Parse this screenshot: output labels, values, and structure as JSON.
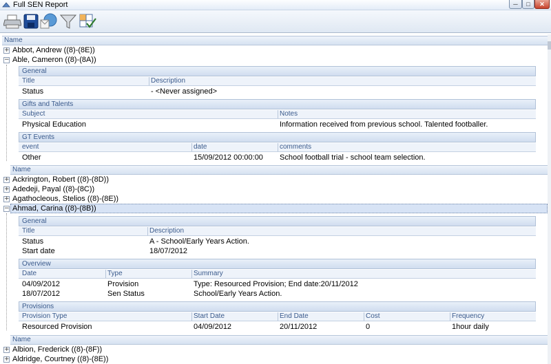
{
  "window": {
    "title": "Full SEN Report"
  },
  "toolbar": {
    "buttons": [
      {
        "name": "print-icon"
      },
      {
        "name": "save-icon"
      },
      {
        "name": "email-icon"
      },
      {
        "name": "filter-icon"
      },
      {
        "name": "columns-icon"
      }
    ]
  },
  "report": {
    "name_header": "Name",
    "students": [
      {
        "label": "Abbot, Andrew ((8)-(8E))",
        "expanded": false
      },
      {
        "label": "Able, Cameron ((8)-(8A))",
        "expanded": true
      },
      {
        "label": "Ackrington, Robert ((8)-(8D))",
        "expanded": false
      },
      {
        "label": "Adedeji, Payal ((8)-(8C))",
        "expanded": false
      },
      {
        "label": "Agathocleous, Stelios ((8)-(8E))",
        "expanded": false
      },
      {
        "label": "Ahmad, Carina ((8)-(8B))",
        "expanded": true,
        "selected": true
      },
      {
        "label": "Albion, Frederick ((8)-(8F))",
        "expanded": false
      },
      {
        "label": "Aldridge, Courtney ((8)-(8E))",
        "expanded": false
      }
    ],
    "able": {
      "general": {
        "title": "General",
        "cols": [
          "Title",
          "Description"
        ],
        "rows": [
          [
            "Status",
            " - <Never assigned>"
          ]
        ]
      },
      "gifts": {
        "title": "Gifts and Talents",
        "cols": [
          "Subject",
          "Notes"
        ],
        "rows": [
          [
            "Physical Education",
            "Information received from previous school. Talented footballer."
          ]
        ]
      },
      "gt_events": {
        "title": "GT Events",
        "cols": [
          "event",
          "date",
          "comments"
        ],
        "rows": [
          [
            "Other",
            "15/09/2012 00:00:00",
            "School football trial - school team selection."
          ]
        ]
      }
    },
    "ahmad": {
      "general": {
        "title": "General",
        "cols": [
          "Title",
          "Description"
        ],
        "rows": [
          [
            "Status",
            "A - School/Early Years Action."
          ],
          [
            "Start date",
            "18/07/2012"
          ]
        ]
      },
      "overview": {
        "title": "Overview",
        "cols": [
          "Date",
          "Type",
          "Summary"
        ],
        "rows": [
          [
            "04/09/2012",
            "Provision",
            "Type: Resourced Provision; End date:20/11/2012"
          ],
          [
            "18/07/2012",
            "Sen Status",
            "School/Early Years Action."
          ]
        ]
      },
      "provisions": {
        "title": "Provisions",
        "cols": [
          "Provision Type",
          "Start Date",
          "End Date",
          "Cost",
          "Frequency"
        ],
        "rows": [
          [
            "Resourced Provision",
            "04/09/2012",
            "20/11/2012",
            "0",
            "1hour daily"
          ]
        ]
      }
    }
  }
}
